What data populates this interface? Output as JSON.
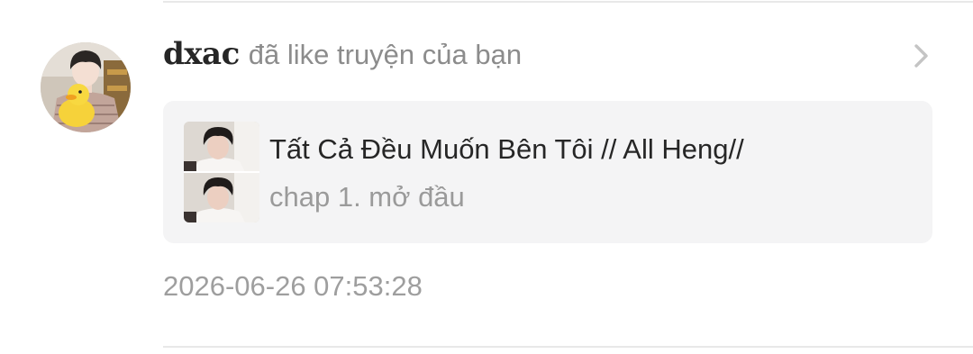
{
  "notification": {
    "username": "dxac",
    "action": "đã like truyện của bạn",
    "story": {
      "title": "Tất Cả Đều Muốn Bên Tôi // All Heng//",
      "chapter": "chap 1. mở đầu"
    },
    "timestamp": "2026-06-26 07:53:28"
  },
  "icons": {
    "open": "chevron-right-icon"
  },
  "colors": {
    "username": "#262626",
    "secondary_text": "#8c8c8c",
    "card_background": "#f4f4f5",
    "divider": "#e8e8e8"
  }
}
